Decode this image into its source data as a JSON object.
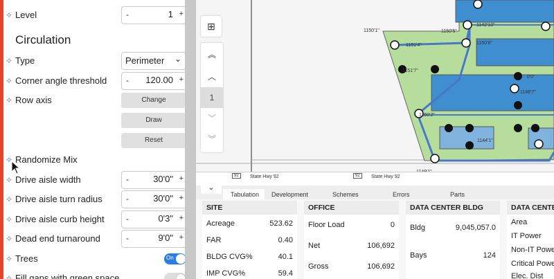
{
  "sidebar": {
    "level": {
      "label": "Level",
      "value": "1",
      "minus": "-",
      "plus": "+"
    },
    "circulation_title": "Circulation",
    "type": {
      "label": "Type",
      "value": "Perimeter"
    },
    "corner_angle": {
      "label": "Corner angle threshold",
      "value": "120.00",
      "minus": "-",
      "plus": "+"
    },
    "row_axis": {
      "label": "Row axis",
      "buttons": [
        "Change",
        "Draw",
        "Reset"
      ]
    },
    "randomize": {
      "label": "Randomize Mix"
    },
    "drive_aisle_width": {
      "label": "Drive aisle width",
      "value": "30'0\"",
      "minus": "-",
      "plus": "+"
    },
    "drive_aisle_turn": {
      "label": "Drive aisle turn radius",
      "value": "30'0\"",
      "minus": "-",
      "plus": "+"
    },
    "drive_aisle_curb": {
      "label": "Drive aisle curb height",
      "value": "0'3\"",
      "minus": "-",
      "plus": "+"
    },
    "dead_end": {
      "label": "Dead end turnaround",
      "value": "9'0\"",
      "minus": "-",
      "plus": "+"
    },
    "trees": {
      "label": "Trees",
      "toggle": "On"
    },
    "fill_gaps": {
      "label": "Fill gaps with green space"
    }
  },
  "map": {
    "page_button": "1",
    "roads": [
      "State Hwy 92",
      "State Hwy 92"
    ],
    "route_shield": "92",
    "dimension_labels": [
      "1150'1\"",
      "1150'5\"",
      "1142'10\"",
      "1151'4\"",
      "1150'8\"",
      "1151'7\"",
      "1148'7\"",
      "1150'2\"",
      "1144'1\"",
      "1149'1\"",
      "0'0\""
    ]
  },
  "tabs": [
    "Tabulation",
    "Development",
    "Schemes",
    "Errors",
    "Parts"
  ],
  "site": {
    "title": "SITE",
    "rows": [
      {
        "label": "Acreage",
        "value": "523.62"
      },
      {
        "label": "FAR",
        "value": "0.40"
      },
      {
        "label": "BLDG CVG%",
        "value": "40.1"
      },
      {
        "label": "IMP CVG%",
        "value": "59.4"
      }
    ]
  },
  "office": {
    "title": "OFFICE",
    "rows": [
      {
        "label": "Floor Load",
        "value": "0"
      },
      {
        "label": "Net",
        "value": "106,692"
      },
      {
        "label": "Gross",
        "value": "106,692"
      }
    ]
  },
  "dc_bldg": {
    "title": "DATA CENTER BLDG",
    "rows": [
      {
        "label": "Bldg",
        "value": "9,045,057.0"
      },
      {
        "label": "Bays",
        "value": "124"
      }
    ]
  },
  "dc": {
    "title": "DATA CENTE",
    "rows": [
      {
        "label": "Area"
      },
      {
        "label": "IT Power"
      },
      {
        "label": "Non-IT Powe"
      },
      {
        "label": "Critical Powe"
      },
      {
        "label": "Elec. Dist"
      }
    ]
  },
  "colors": {
    "accent": "#2a7ee0",
    "site_green": "#b6dd9b",
    "building_blue": "#3f8fd0"
  }
}
